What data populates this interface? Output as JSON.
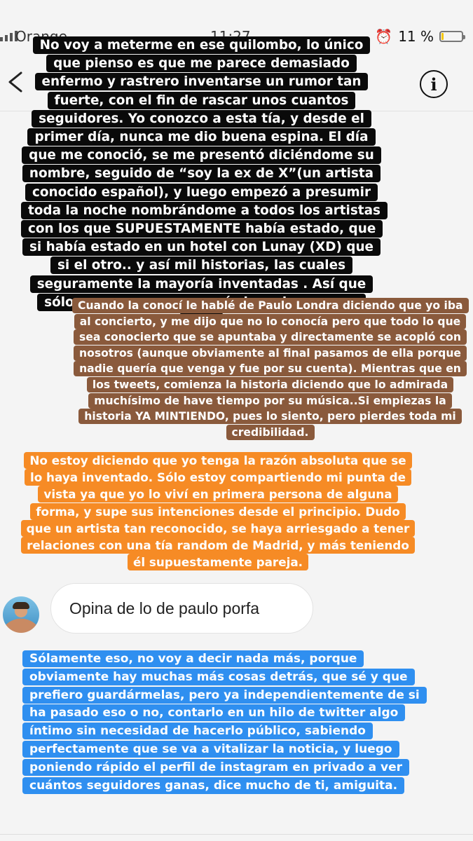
{
  "status_bar": {
    "carrier": "Orange",
    "time": "11:27",
    "battery_percent": "11 %",
    "battery_level": 0.11,
    "icons": [
      "signal-icon",
      "wifi-icon",
      "alarm-icon",
      "battery-icon"
    ]
  },
  "header": {
    "back_icon": "chevron-left-icon",
    "info_label": "i"
  },
  "stories": {
    "black": "No voy a meterme en ese quilombo, lo único que pienso es que me parece demasiado enfermo y rastrero inventarse un rumor tan fuerte, con el fin de rascar unos cuantos seguidores. Yo conozco a esta tía, y desde el primer día, nunca me dio buena espina. El día que me conoció, se me presentó diciéndome su nombre, seguido de “soy la ex de X”(un artista conocido español), y luego empezó a presumir toda la noche nombrándome a todos los artistas con los que SUPUESTAMENTE había estado, que si había estado en un hotel con Lunay (XD) que si el otro.. y así mil historias, las cuales seguramente la mayoría inventadas . Así que sólo con eso, ya supe qué clase de persona era.",
    "brown": "Cuando la conocí le hablé de Paulo Londra diciendo que yo iba al concierto, y me dijo que no lo conocía pero que todo lo que sea conocierto que se apuntaba y directamente se acopló con nosotros (aunque obviamente al final pasamos de ella porque nadie quería que venga y fue por su cuenta). Mientras que en los tweets, comienza la historia diciendo que lo admirada muchísimo de have tiempo por su música..Si empiezas la historia YA MINTIENDO, pues lo siento, pero pierdes toda mi credibilidad.",
    "orange": "No estoy diciendo que yo tenga la razón absoluta que se lo haya inventado. Sólo estoy compartiendo mi punta de vista ya que yo lo viví en primera persona de alguna forma, y supe sus intenciones desde el principio. Dudo que un artista tan reconocido, se haya arriesgado a tener relaciones con una tía random de Madrid, y más teniendo él supuestamente pareja.",
    "blue": "Sólamente eso, no voy a decir nada más, porque obviamente hay muchas más cosas detrás, que sé y que prefiero guardármelas, pero ya independientemente de si ha pasado eso o no, contarlo en un hilo de twitter algo íntimo sin necesidad de hacerlo público, sabiendo perfectamente que se va a vitalizar la noticia, y luego poniendo rápido el perfil de instagram en privado a ver cuántos seguidores ganas, dice mucho de ti, amiguita."
  },
  "message": {
    "text": "Opina de lo de paulo porfa",
    "avatar_icon": "avatar"
  },
  "colors": {
    "black_bg": "#0a0a0a",
    "brown_bg": "#8a5a3c",
    "orange_bg": "#f68b25",
    "blue_bg": "#2f8ff0"
  }
}
